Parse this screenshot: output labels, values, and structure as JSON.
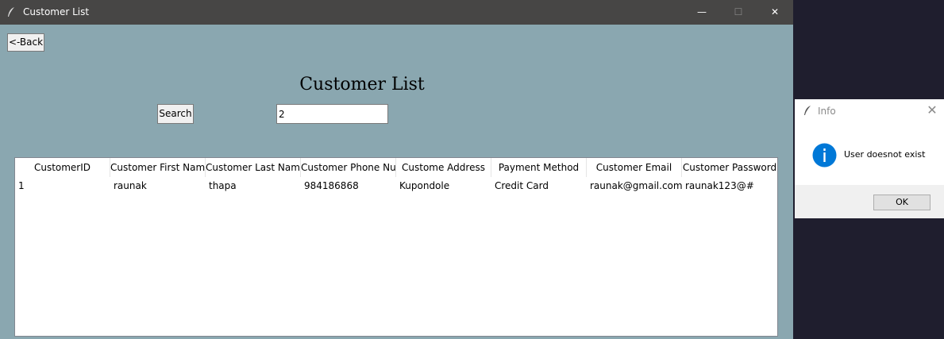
{
  "window": {
    "title": "Customer List",
    "controls": {
      "minimize": "—",
      "maximize": "☐",
      "close": "✕"
    }
  },
  "back_button": {
    "label": "<-Back"
  },
  "heading": "Customer List",
  "search": {
    "button_label": "Search",
    "value": "2"
  },
  "table": {
    "columns": [
      "CustomerID",
      "Customer First Name",
      "Customer Last Name",
      "Customer Phone Nur",
      "Custome Address",
      "Payment Method",
      "Customer Email",
      "Customer Password"
    ],
    "rows": [
      [
        "1",
        "raunak",
        "thapa",
        "984186868",
        "Kupondole",
        "Credit Card",
        "raunak@gmail.com",
        "raunak123@#"
      ]
    ]
  },
  "dialog": {
    "title": "Info",
    "message": "User doesnot exist",
    "ok_label": "OK",
    "icon": "info-icon",
    "close_glyph": "✕"
  },
  "colors": {
    "window_bg": "#8aa7b0",
    "titlebar": "#474645",
    "desktop": "#1f1e2e",
    "info_blue": "#0078d7"
  }
}
